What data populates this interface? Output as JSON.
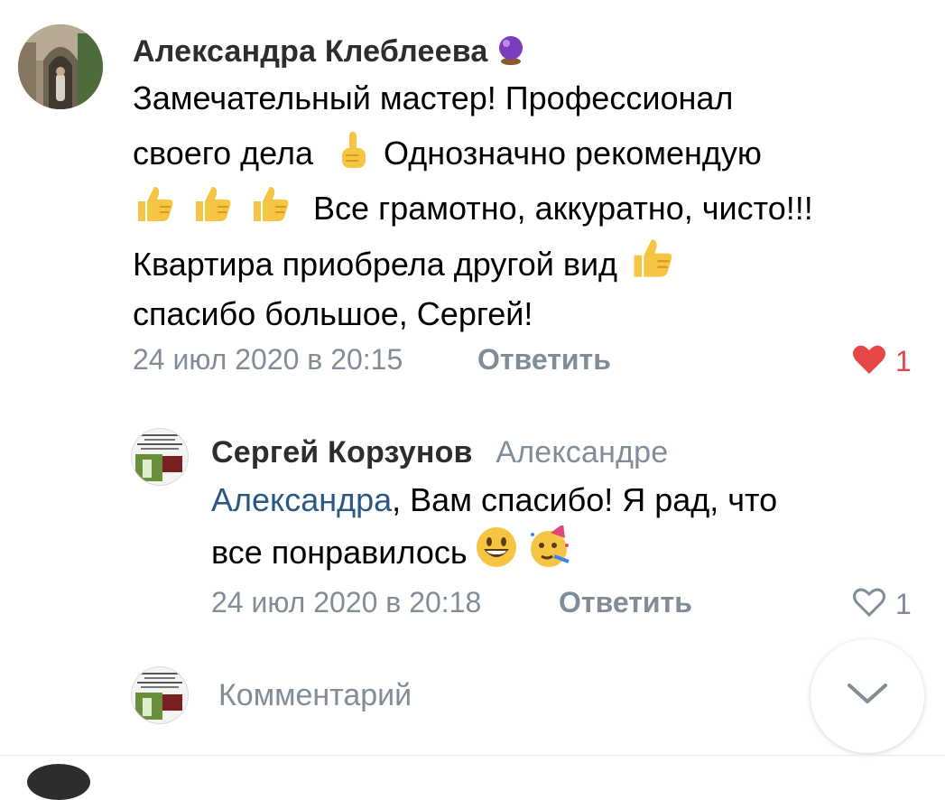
{
  "comment": {
    "author": "Александра Клеблеева",
    "author_badge_icon": "crystal-ball-icon",
    "lines": [
      "Замечательный мастер! Профессионал",
      "своего дела",
      "Однозначно рекомендую",
      "Все грамотно, аккуратно, чисто!!!",
      "Квартира приобрела другой вид",
      "спасибо большое, Сергей!"
    ],
    "timestamp": "24 июл 2020 в 20:15",
    "reply_label": "Ответить",
    "likes": "1",
    "liked": true
  },
  "reply": {
    "author": "Сергей Корзунов",
    "addressee": "Александре",
    "mention": "Александра",
    "line1_rest": ", Вам спасибо! Я рад, что",
    "line2": "все понравилось",
    "timestamp": "24 июл 2020 в 20:18",
    "reply_label": "Ответить",
    "likes": "1",
    "liked": false
  },
  "composer": {
    "placeholder": "Комментарий"
  },
  "colors": {
    "text": "#000000",
    "secondary": "#818c99",
    "link": "#2a5885",
    "like_active": "#e64646"
  }
}
